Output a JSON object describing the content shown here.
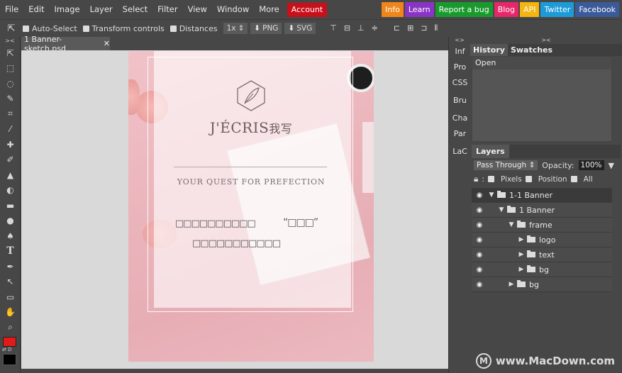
{
  "menubar": {
    "items": [
      "File",
      "Edit",
      "Image",
      "Layer",
      "Select",
      "Filter",
      "View",
      "Window",
      "More"
    ],
    "account": "Account",
    "links": [
      {
        "label": "Info",
        "color": "#f0861a"
      },
      {
        "label": "Learn",
        "color": "#8a34c6"
      },
      {
        "label": "Report a bug",
        "color": "#1a9a2e"
      },
      {
        "label": "Blog",
        "color": "#e6276a"
      },
      {
        "label": "API",
        "color": "#f3b512"
      },
      {
        "label": "Twitter",
        "color": "#1d9bd8"
      },
      {
        "label": "Facebook",
        "color": "#3b5a9a"
      }
    ]
  },
  "options": {
    "auto_select": "Auto-Select",
    "transform_controls": "Transform controls",
    "distances": "Distances",
    "scale": "1x",
    "png": "PNG",
    "svg": "SVG"
  },
  "document": {
    "tab_title": "1 Banner-sketch.psd",
    "close": "✕"
  },
  "artwork": {
    "brand": "J'ÉCRIS",
    "brand_cn": "我写",
    "tagline": "YOUR QUEST FOR PREFECTION",
    "line1_boxes": "□□□□□□□□□□",
    "quote": "“□□□”",
    "line2_boxes": "□□□□□□□□□□□"
  },
  "side_tabs": [
    "Inf",
    "Pro",
    "CSS",
    "Bru",
    "Cha",
    "Par",
    "LaC"
  ],
  "history": {
    "tabs": [
      "History",
      "Swatches"
    ],
    "entries": [
      "Open"
    ]
  },
  "layers_panel": {
    "tab": "Layers",
    "blend_mode": "Pass Through",
    "opacity_label": "Opacity:",
    "opacity_value": "100%",
    "lock_label": ":",
    "lock_pixels": "Pixels",
    "lock_position": "Position",
    "lock_all": "All",
    "layers": [
      {
        "name": "1-1 Banner",
        "depth": 0,
        "expanded": true,
        "selected": true
      },
      {
        "name": "1 Banner",
        "depth": 1,
        "expanded": true,
        "selected": false
      },
      {
        "name": "frame",
        "depth": 2,
        "expanded": true,
        "selected": false
      },
      {
        "name": "logo",
        "depth": 3,
        "expanded": false,
        "selected": false
      },
      {
        "name": "text",
        "depth": 3,
        "expanded": false,
        "selected": false
      },
      {
        "name": "bg",
        "depth": 3,
        "expanded": false,
        "selected": false
      },
      {
        "name": "bg",
        "depth": 2,
        "expanded": false,
        "selected": false
      }
    ]
  },
  "watermark": "www.MacDown.com",
  "colors": {
    "foreground": "#e11a1a",
    "background": "#000000"
  }
}
